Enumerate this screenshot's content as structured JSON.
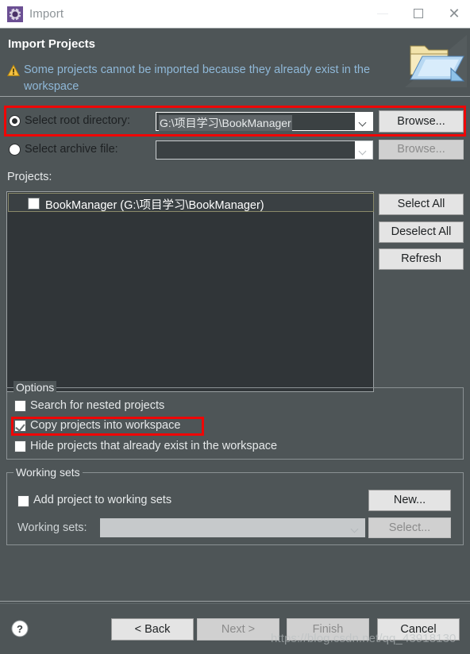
{
  "window": {
    "title": "Import",
    "icon": "eclipse-import-gear-icon",
    "controls": {
      "minimize": "minimize-icon",
      "maximize": "maximize-icon",
      "close": "close-icon"
    }
  },
  "header": {
    "title": "Import Projects",
    "message": "Some projects cannot be imported because they already exist in the workspace",
    "warning_icon": "warning-triangle-icon",
    "banner_icon": "open-folder-import-icon",
    "message_color": "#8fb8d8",
    "background_color": "#4e5557"
  },
  "source": {
    "root_directory": {
      "label": "Select root directory:",
      "selected": true,
      "value": "G:\\项目学习\\BookManager",
      "browse_label": "Browse...",
      "browse_enabled": true
    },
    "archive_file": {
      "label": "Select archive file:",
      "selected": false,
      "value": "",
      "browse_label": "Browse...",
      "browse_enabled": false
    }
  },
  "projects": {
    "label": "Projects:",
    "items": [
      {
        "name": "BookManager (G:\\项目学习\\BookManager)",
        "checked": false,
        "selected": true
      }
    ],
    "buttons": {
      "select_all": "Select All",
      "deselect_all": "Deselect All",
      "refresh": "Refresh"
    }
  },
  "options": {
    "title": "Options",
    "items": [
      {
        "label": "Search for nested projects",
        "checked": false
      },
      {
        "label": "Copy projects into workspace",
        "checked": true
      },
      {
        "label": "Hide projects that already exist in the workspace",
        "checked": false
      }
    ]
  },
  "working_sets": {
    "title": "Working sets",
    "add_checkbox": {
      "label": "Add project to working sets",
      "checked": false
    },
    "combo_label": "Working sets:",
    "combo_value": "",
    "new_button": {
      "label": "New...",
      "enabled": true
    },
    "select_button": {
      "label": "Select...",
      "enabled": false
    }
  },
  "footer": {
    "help_icon": "help-question-icon",
    "buttons": [
      {
        "label": "< Back",
        "enabled": true
      },
      {
        "label": "Next >",
        "enabled": false
      },
      {
        "label": "Finish",
        "enabled": false
      },
      {
        "label": "Cancel",
        "enabled": true
      }
    ]
  },
  "annotations": {
    "highlight_color": "#f00606",
    "boxes": [
      "root-directory-row",
      "copy-projects-into-workspace"
    ]
  },
  "watermark": "https://blog.csdn.net/qq_43918130"
}
